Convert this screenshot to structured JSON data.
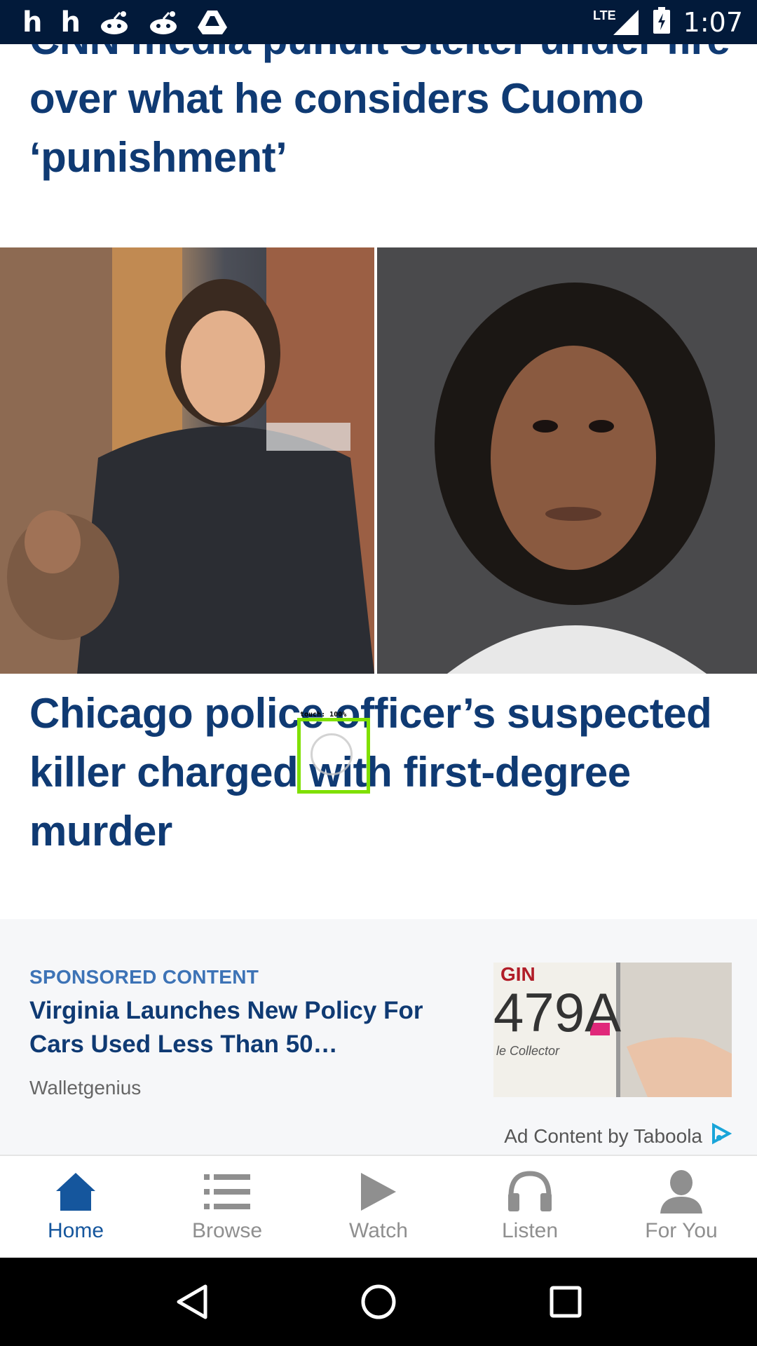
{
  "status_bar": {
    "time": "1:07",
    "network": "LTE",
    "left_icons": [
      "h",
      "h",
      "reddit-icon",
      "reddit-icon",
      "drive-icon"
    ]
  },
  "feed": {
    "story1": {
      "headline": "CNN media pundit Stelter under fire over what he considers Cuomo ‘punishment’"
    },
    "story2": {
      "headline": "Chicago police officer’s suspected killer charged with first-degree murder"
    },
    "sponsored": {
      "tag": "SPONSORED CONTENT",
      "title": "Virginia Launches New Policy For Cars Used Less Than 50…",
      "source": "Walletgenius",
      "plate_text": "479A",
      "plate_sub": "le Collector",
      "plate_top": "GIN",
      "credit": "Ad Content by Taboola"
    }
  },
  "touch_overlay": {
    "label": "touch: 100%"
  },
  "bottom_nav": [
    {
      "label": "Home",
      "icon": "home-icon",
      "active": true
    },
    {
      "label": "Browse",
      "icon": "list-icon",
      "active": false
    },
    {
      "label": "Watch",
      "icon": "play-icon",
      "active": false
    },
    {
      "label": "Listen",
      "icon": "headphones-icon",
      "active": false
    },
    {
      "label": "For You",
      "icon": "person-icon",
      "active": false
    }
  ],
  "colors": {
    "headline": "#0f3a73",
    "accent": "#15569d",
    "status_bar": "#021a3a",
    "inactive": "#8f8f8f"
  }
}
